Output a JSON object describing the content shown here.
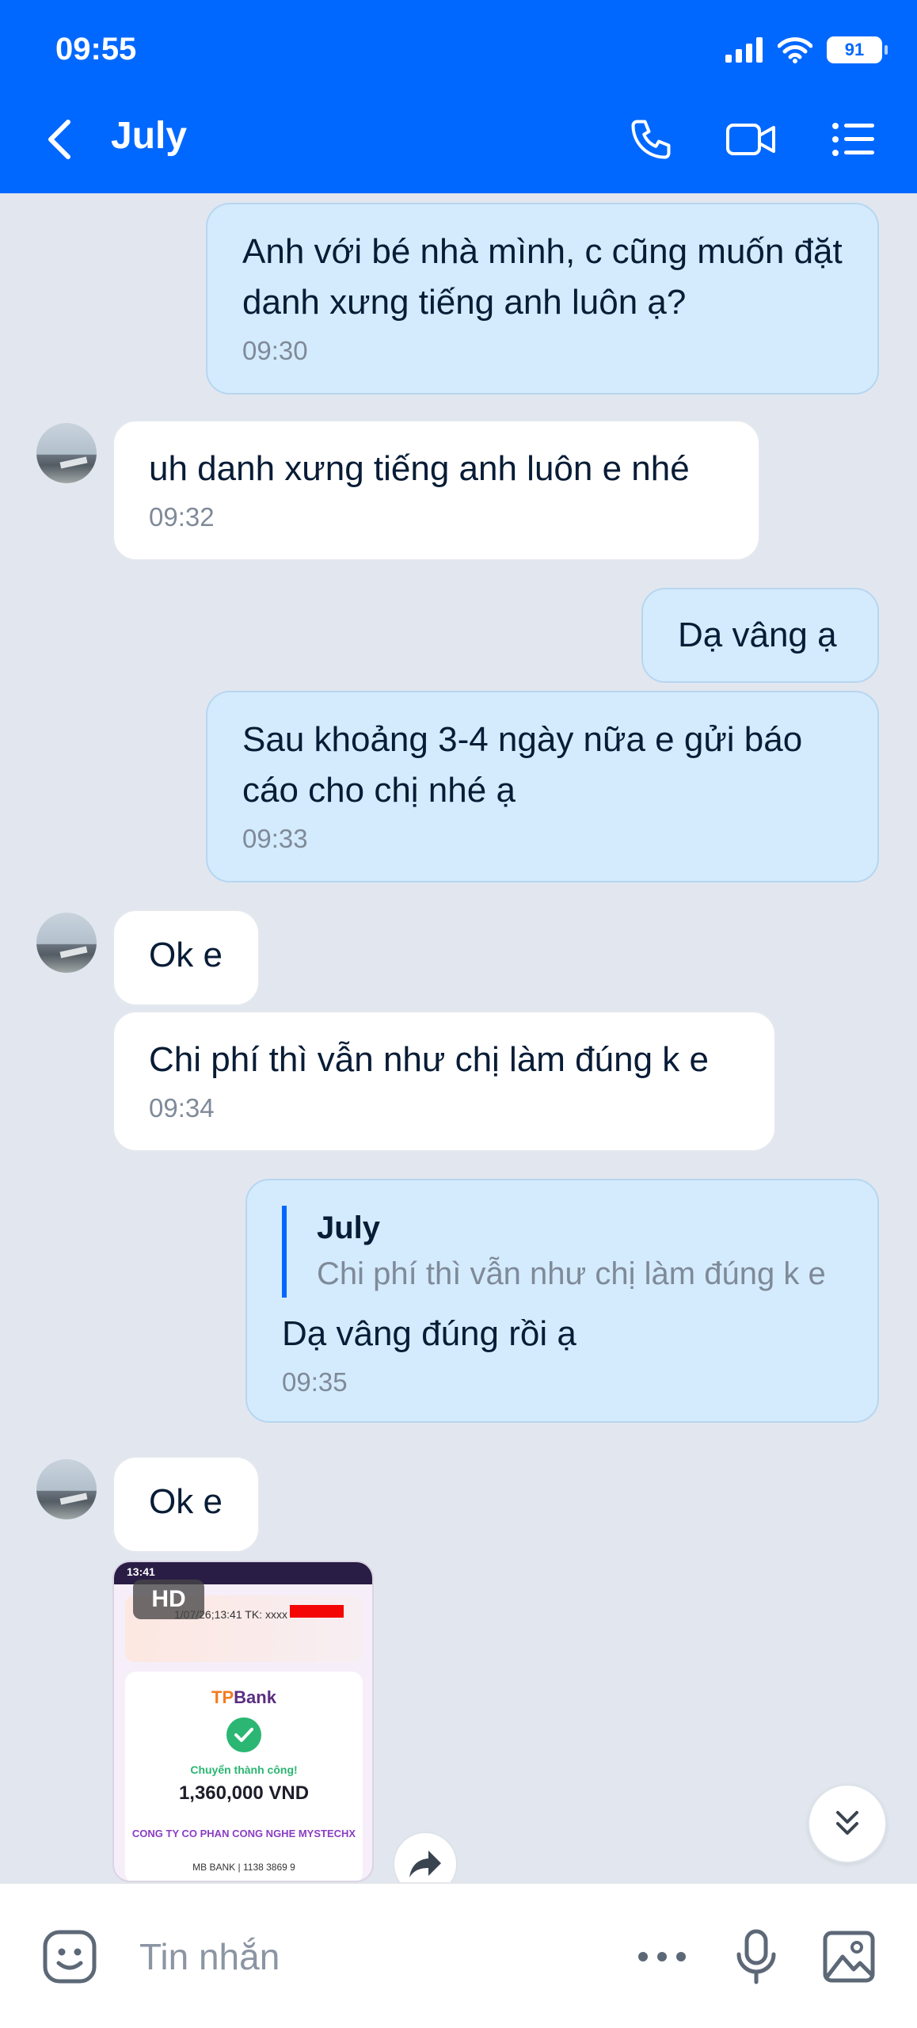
{
  "status_bar": {
    "time": "09:55",
    "battery": "91"
  },
  "header": {
    "contact_name": "July"
  },
  "messages": [
    {
      "text": "Anh với bé nhà mình, c cũng muốn đặt danh xưng tiếng anh luôn ạ?",
      "time": "09:30"
    },
    {
      "text": "uh danh xưng tiếng anh luôn e nhé",
      "time": "09:32"
    },
    {
      "text": "Dạ vâng ạ"
    },
    {
      "text": "Sau khoảng 3-4 ngày nữa e gửi báo cáo cho chị nhé ạ",
      "time": "09:33"
    },
    {
      "text": "Ok e"
    },
    {
      "text": "Chi phí thì vẫn như chị làm đúng k e",
      "time": "09:34"
    },
    {
      "quote_name": "July",
      "quote_text": "Chi phí thì vẫn như chị làm đúng k e",
      "text": "Dạ vâng đúng rồi ạ",
      "time": "09:35"
    },
    {
      "text": "Ok e"
    }
  ],
  "image_message": {
    "hd_label": "HD",
    "phone_time": "13:41",
    "banner_text": "1/07/26;13:41 TK: xxxx",
    "bank_name_a": "TP",
    "bank_name_b": "Bank",
    "success_text": "Chuyển thành công!",
    "amount": "1,360,000 VND",
    "recipient": "CONG TY CO PHAN CONG NGHE MYSTECHX",
    "recipient_bank": "MB BANK",
    "account_no": "1138 3869 9"
  },
  "composer": {
    "placeholder": "Tin nhắn"
  }
}
